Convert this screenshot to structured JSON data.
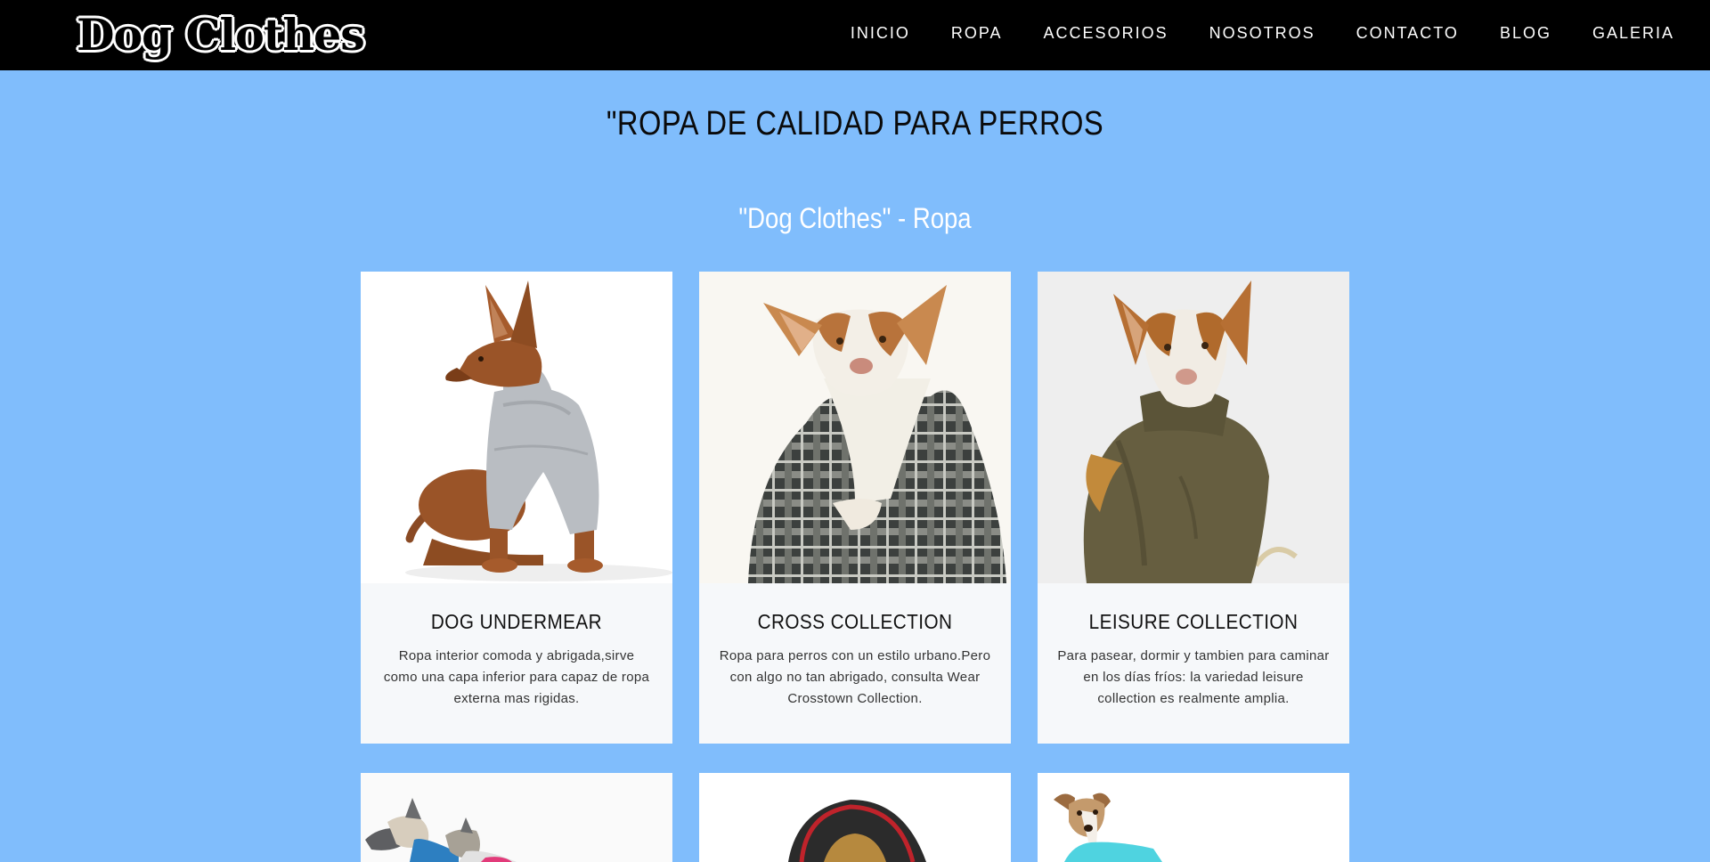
{
  "brand": {
    "logo_text": "Dog Clothes"
  },
  "nav": {
    "items": [
      {
        "label": "INICIO"
      },
      {
        "label": "ROPA"
      },
      {
        "label": "ACCESORIOS"
      },
      {
        "label": "NOSOTROS"
      },
      {
        "label": "CONTACTO"
      },
      {
        "label": "BLOG"
      },
      {
        "label": "GALERIA"
      }
    ]
  },
  "hero": {
    "title": "\"ROPA DE CALIDAD PARA PERROS",
    "subtitle": "\"Dog Clothes\" - Ropa"
  },
  "products": [
    {
      "title": "DOG UNDERMEAR",
      "description": "Ropa interior comoda y abrigada,sirve como una capa inferior para capaz de ropa externa mas rigidas."
    },
    {
      "title": "CROSS COLLECTION",
      "description": "Ropa para perros con un estilo urbano.Pero con algo no tan abrigado, consulta Wear Crosstown Collection."
    },
    {
      "title": "LEISURE COLLECTION",
      "description": "Para pasear, dormir y tambien para caminar en los días fríos: la variedad leisure collection es realmente amplia."
    }
  ],
  "colors": {
    "page_background": "#80bdfc",
    "navbar_background": "#000000",
    "card_background": "#f6f8fa"
  }
}
